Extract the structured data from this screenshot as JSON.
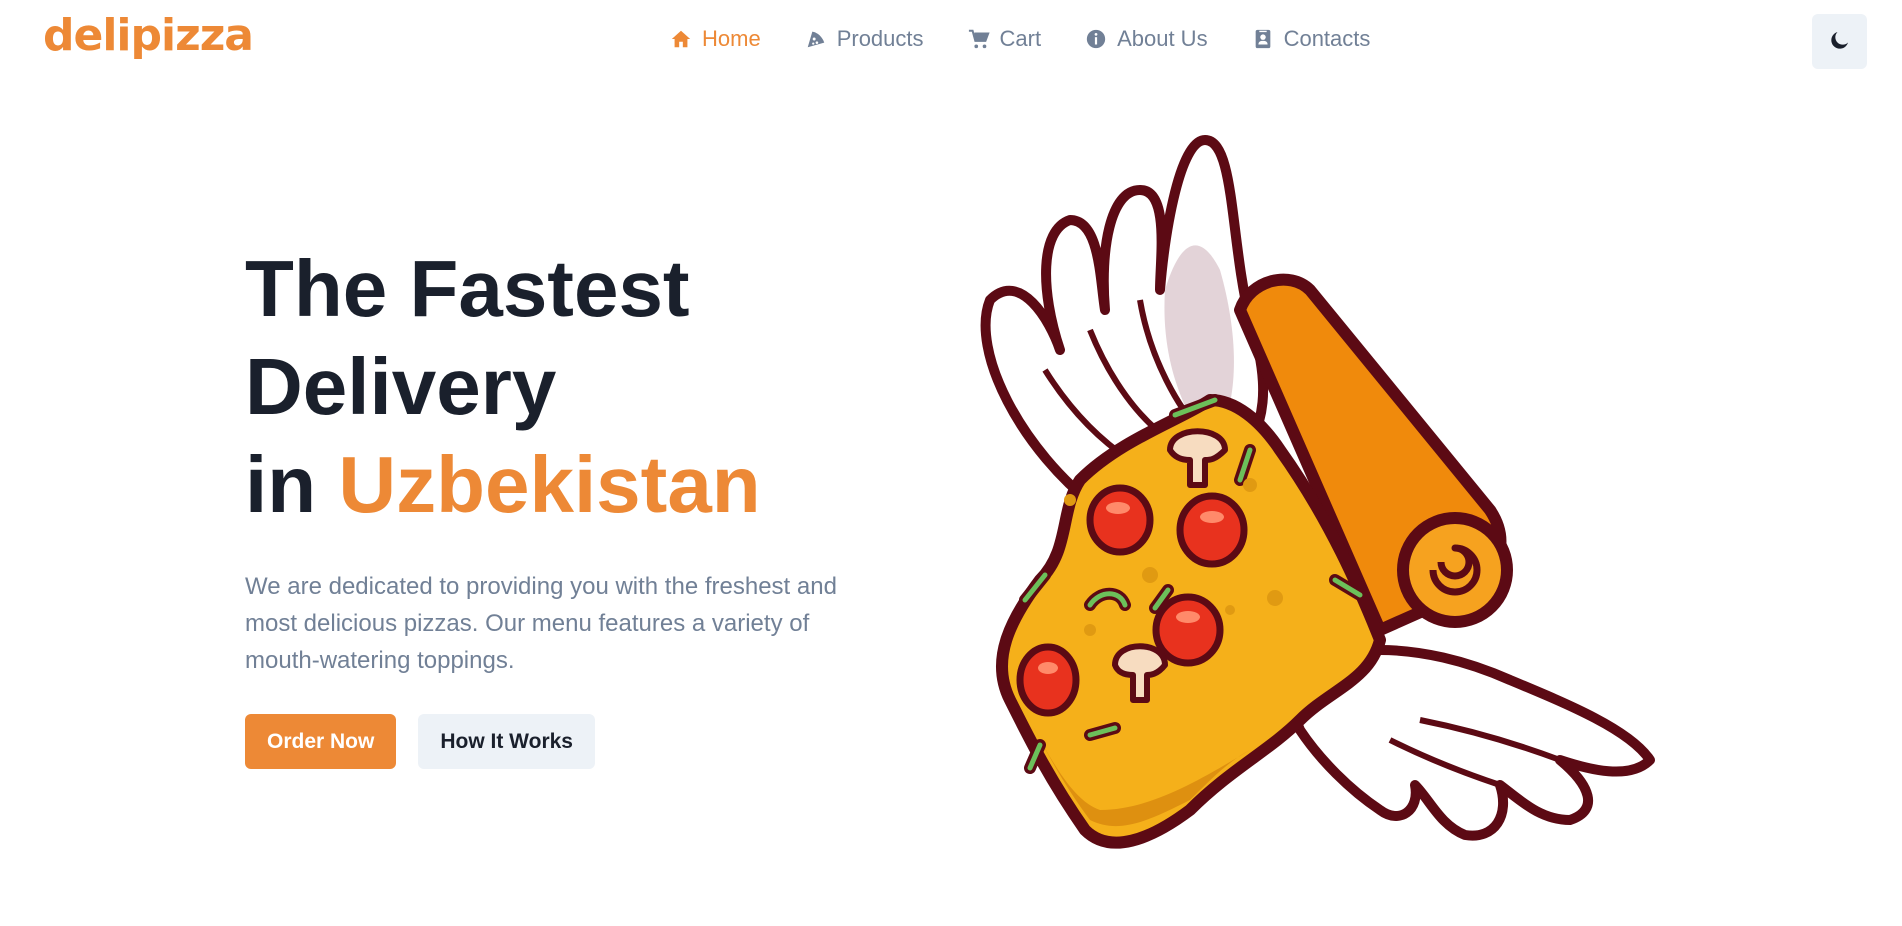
{
  "brand": {
    "logo_text": "delipizza",
    "accent": "#ED8936"
  },
  "nav": {
    "items": [
      {
        "label": "Home",
        "icon": "home-icon",
        "active": true
      },
      {
        "label": "Products",
        "icon": "pizza-slice-icon",
        "active": false
      },
      {
        "label": "Cart",
        "icon": "cart-icon",
        "active": false
      },
      {
        "label": "About Us",
        "icon": "info-icon",
        "active": false
      },
      {
        "label": "Contacts",
        "icon": "contact-card-icon",
        "active": false
      }
    ]
  },
  "theme_toggle": {
    "icon": "moon-icon"
  },
  "hero": {
    "title_line1": "The Fastest",
    "title_line2": "Delivery",
    "title_line3_prefix": "in",
    "title_line3_accent": "Uzbekistan",
    "description": "We are dedicated to providing you with the freshest and most delicious pizzas. Our menu features a variety of mouth-watering toppings.",
    "primary_button": "Order Now",
    "secondary_button": "How It Works",
    "illustration": "winged-pizza-slice-illustration"
  },
  "colors": {
    "text_dark": "#1A202C",
    "text_muted": "#718096",
    "button_light": "#EDF2F7"
  }
}
